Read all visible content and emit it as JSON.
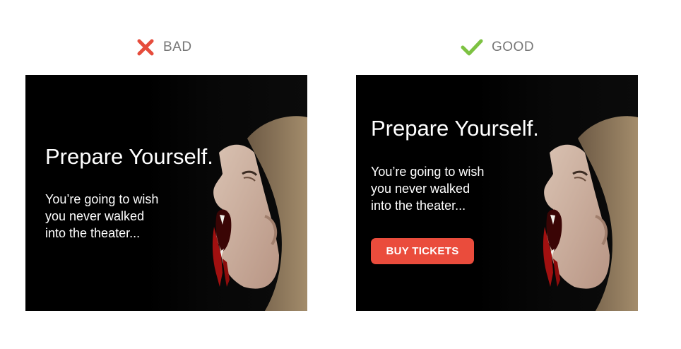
{
  "comparison": {
    "bad": {
      "verdict_label": "BAD",
      "icon": "cross-icon",
      "icon_color": "#e64c3c",
      "ad": {
        "headline": "Prepare Yourself.",
        "body_lines": [
          "You’re going to wish",
          "you never walked",
          "into the theater..."
        ]
      }
    },
    "good": {
      "verdict_label": "GOOD",
      "icon": "checkmark-icon",
      "icon_color": "#7dc242",
      "ad": {
        "headline": "Prepare Yourself.",
        "body_lines": [
          "You’re going to wish",
          "you never walked",
          "into the theater..."
        ],
        "cta_label": "BUY TICKETS",
        "cta_color": "#ea4c3c"
      }
    }
  }
}
